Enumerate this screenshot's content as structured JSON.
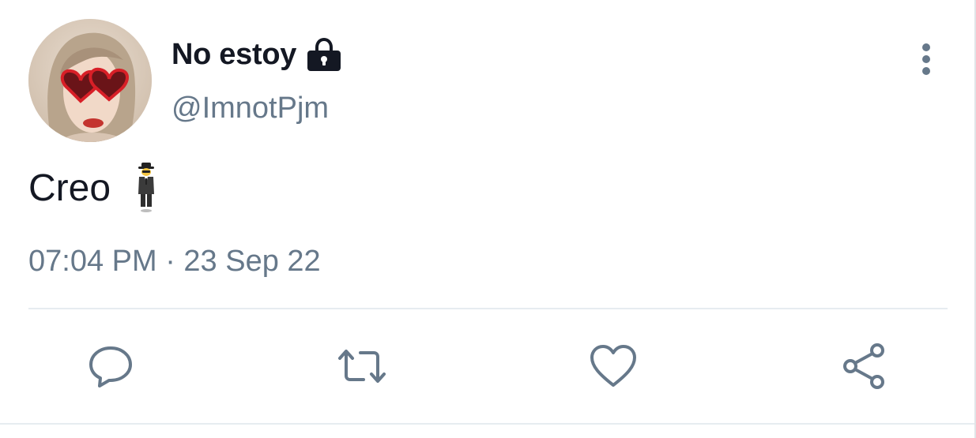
{
  "tweet": {
    "display_name": "No estoy",
    "handle": "@ImnotPjm",
    "text": "Creo",
    "timestamp": "07:04 PM · 23 Sep 22",
    "icons": {
      "avatar": "avatar",
      "lock": "lock-icon",
      "emoji": "man-in-business-suit-levitating-emoji",
      "more": "more-vertical-icon"
    }
  },
  "actions": [
    {
      "name": "reply",
      "icon": "reply-icon"
    },
    {
      "name": "retweet",
      "icon": "retweet-icon"
    },
    {
      "name": "like",
      "icon": "heart-icon"
    },
    {
      "name": "share",
      "icon": "share-icon"
    }
  ],
  "colors": {
    "text_primary": "#141823",
    "text_secondary": "#66788a",
    "icon": "#66788a",
    "divider": "#e6ecf0"
  }
}
